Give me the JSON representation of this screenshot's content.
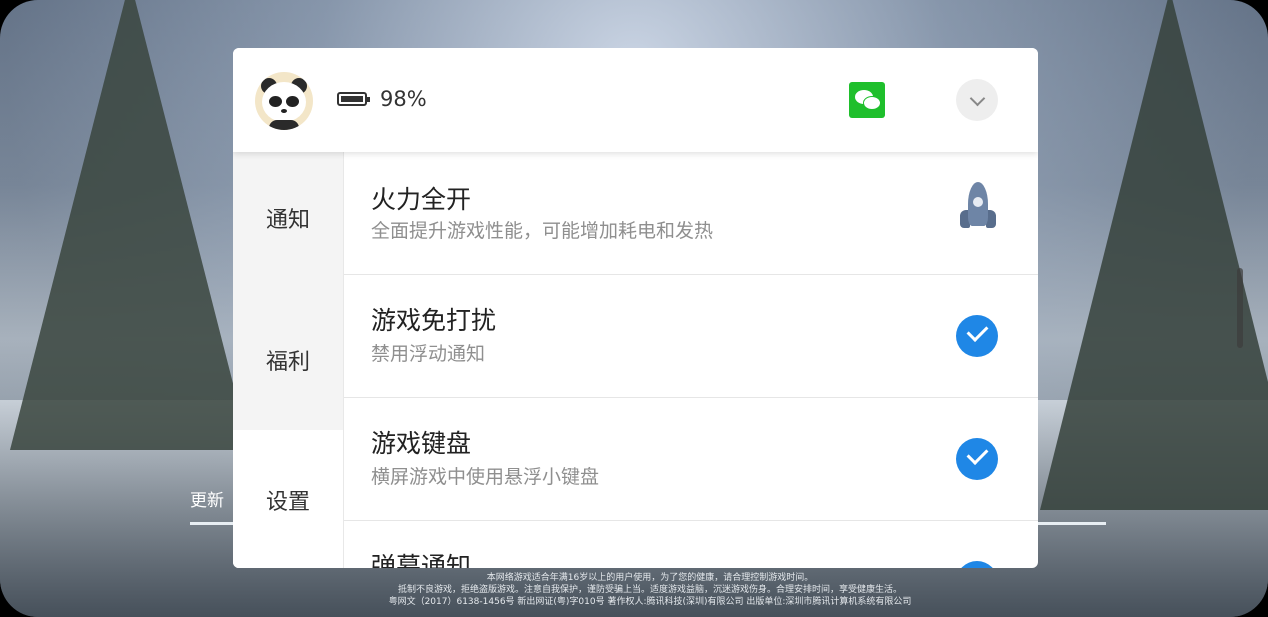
{
  "background": {
    "update_label": "更新",
    "notice_lines": [
      "本网络游戏适合年满16岁以上的用户使用，为了您的健康，请合理控制游戏时间。",
      "抵制不良游戏，拒绝盗版游戏。注意自我保护，谨防受骗上当。适度游戏益脑，沉迷游戏伤身。合理安排时间，享受健康生活。",
      "粤网文（2017）6138-1456号 新出网证(粤)字010号 著作权人:腾讯科技(深圳)有限公司 出版单位:深圳市腾讯计算机系统有限公司"
    ]
  },
  "header": {
    "avatar_icon": "panda-avatar-icon",
    "battery_icon": "battery-icon",
    "battery_percent": "98%",
    "wechat_icon": "wechat-icon",
    "collapse_icon": "chevron-down-icon"
  },
  "sidebar": {
    "tabs": [
      {
        "label": "通知"
      },
      {
        "label": "福利"
      },
      {
        "label": "设置",
        "selected": true
      }
    ]
  },
  "settings": {
    "items": [
      {
        "title": "火力全开",
        "subtitle": "全面提升游戏性能，可能增加耗电和发热",
        "icon": "rocket-icon"
      },
      {
        "title": "游戏免打扰",
        "subtitle": "禁用浮动通知",
        "icon": "check-icon",
        "checked": true
      },
      {
        "title": "游戏键盘",
        "subtitle": "横屏游戏中使用悬浮小键盘",
        "icon": "check-icon",
        "checked": true
      },
      {
        "title": "弹幕通知",
        "subtitle": "",
        "icon": "check-icon",
        "checked": true
      }
    ]
  },
  "colors": {
    "accent": "#1f87e6",
    "wechat_green": "#1fbf2c",
    "sidebar_bg": "#f4f4f4"
  }
}
